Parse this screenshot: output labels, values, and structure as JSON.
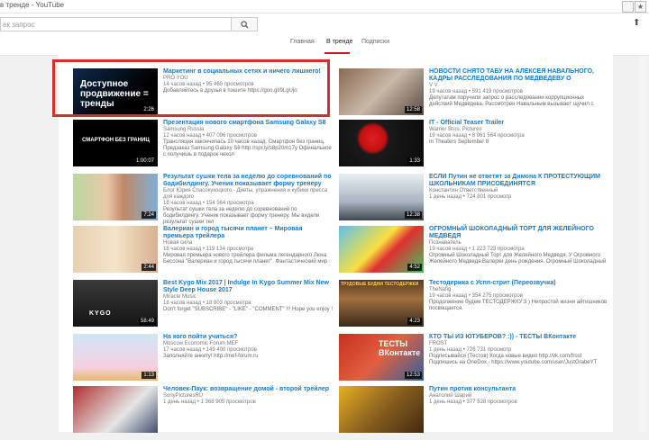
{
  "window": {
    "title": "в тренде - YouTube",
    "btn1": "",
    "btn2": "★"
  },
  "search": {
    "placeholder": "ек запрос",
    "button_icon": "magnifier-icon"
  },
  "tabs": [
    {
      "label": "Главная"
    },
    {
      "label": "В тренде"
    },
    {
      "label": "Подписки"
    }
  ],
  "colors": {
    "link": "#167ac6",
    "accent": "#cc181e",
    "highlight": "#d32f2f"
  },
  "left": [
    {
      "title": "Маркетинг в социальных сетях и ничего лишнего!",
      "channel": "PRO YOU",
      "stats": "14 часов назад • 95 460 просмотров",
      "desc": "Добавляйтесь в друзья в пэшите https://goo.gl/9LgUjo",
      "duration": "2:26",
      "caption": "Доступное продвижение = тренды"
    },
    {
      "title": "Презентация нового смартфона Samsung Galaxy S8",
      "channel": "Samsung Russia",
      "stats": "12 часов назад • 407 096 просмотров",
      "desc": "Трансляция закончилась 10 часов назад. Смартфон без границ. Предзаказ Samsung Galaxy S8 http://spr.ly/s8p20m17y Офинальное с получишь в подарок чехол",
      "duration": "1:00:07",
      "caption": "СМАРТФОН БЕЗ ГРАНИЦ"
    },
    {
      "title": "Результат сушки тела за неделю до соревнований по бодибилдингу. Ученик показывает форму тренеру",
      "channel": "Блог Юрия Спасокукоцкого - Диеты, упражнения и кубики пресса для каждого",
      "stats": "18 часов назад • 154 564 просмотра",
      "desc": "Результат сушки тела за неделю до соревнований по бодибилдингу. Ученик показывает форму тренеру. Мы видели результат сушки тел",
      "duration": "7:24",
      "caption": ""
    },
    {
      "title": "Валериан и город тысячи планет – Мировая премьера трейлера",
      "channel": "Новая сила",
      "stats": "18 часов назад • 119 134 просмотра",
      "desc": "Мировая премьера нового трейлера фильма легендарного Люка Бессона \"Валериан и город тысячи планет\". Фантастический мир",
      "duration": "2:44",
      "caption": ""
    },
    {
      "title": "Best Kygo Mix 2017 | Indulge In Kygo Summer Mix New Style Deep House 2017",
      "channel": "Miracle Music",
      "stats": "18 часов назад • 18 803 просмотра",
      "desc": "Don't forget \"SUBSCRIBE\" - \"LIKE\" - \"COMMENT\" !!! Hope you enjoy !",
      "duration": "58:49",
      "caption": "KYGO"
    },
    {
      "title": "На кого пойти учиться?",
      "channel": "Moscow Economic Forum MEF",
      "stats": "17 часов назад • 149 400 просмотров",
      "desc": "Заполняйте анкету! http://mef-forum.ru",
      "duration": "1:13",
      "caption": ""
    },
    {
      "title": "Человек-Паук: возвращение домой - второй трейлер",
      "channel": "SonyPicturesRU",
      "stats": "1 день назад • 1 368 905 просмотров",
      "desc": "",
      "duration": "",
      "caption": ""
    }
  ],
  "right": [
    {
      "title": "НОВОСТИ СНЯТО ТАБУ НА АЛЕКСЕЯ НАВАЛЬНОГО, КАДРЫ РАССЛЕДОВАНИЯ ПО МЕДВЕДЕВУ О",
      "channel": "V V",
      "stats": "19 часов назад • 591 419 просмотров",
      "desc": "Депутатам поручили запрос о расследовании коррупционных действий Медведева. Рассмотрен Навальным вызывает щучил с",
      "duration": "12:58",
      "caption": ""
    },
    {
      "title": "IT - Official Teaser Trailer",
      "channel": "Warner Bros. Pictures",
      "stats": "19 часов назад • 8 961 564 просмотра",
      "desc": "In Theaters September 8",
      "duration": "1:33",
      "caption": ""
    },
    {
      "title": "ЕСЛИ Путин не ответит за Димона К ПРОТЕСТУЮЩИМ ШКОЛЬНИКАМ ПРИСОЕДИНЯТСЯ",
      "channel": "Константин Ответственный",
      "stats": "1 день назад • 724 801 просмотр",
      "desc": "",
      "duration": "12:38",
      "caption": ""
    },
    {
      "title": "ОГРОМНЫЙ ШОКОЛАДНЫЙ ТОРТ ДЛЯ ЖЕЛЕЙНОГО МЕДВЕДЯ",
      "channel": "Познаватель",
      "stats": "19 часов назад • 1 223 723 просмотра",
      "desc": "Огромный Шоколадный Торт для Желейного Медведя. У Огромного Желейного Медведя Валерки день рождения. Огромный Шоколадный",
      "duration": "4:52",
      "caption": ""
    },
    {
      "title": "Тестодержка с Успп-стрит (Переозвучка)",
      "channel": "TheNafig",
      "stats": "19 часов назад • 354 275 просмотров",
      "desc": "Продолжение будем ТЕСТОДЕРЖКУ:3 ) Непростой жизни айтишников посвящается.",
      "duration": "4:23",
      "caption": "ТРУДОВЫЕ БУДНИ ТЕСТОДЕРЖКИ"
    },
    {
      "title": "КТО ТЫ ИЗ ЮТУБЕРОВ? :)) - ТЕСТЫ ВКонтакте",
      "channel": "FROST",
      "stats": "1 день назад • 726 731 просмотр",
      "desc": "Подписывайся (Тестов) Когда новые видео http://vk.com/frost Подпишись на OneDox - https://www.youtube.com/user/JustGrabeYT",
      "duration": "12:53",
      "caption": "ТЕСТЫ ВКонтакте"
    },
    {
      "title": "Путин против консультанта",
      "channel": "Анатолий Шарий",
      "stats": "1 день назад • 377 528 просмотров",
      "desc": "",
      "duration": "",
      "caption": ""
    }
  ]
}
